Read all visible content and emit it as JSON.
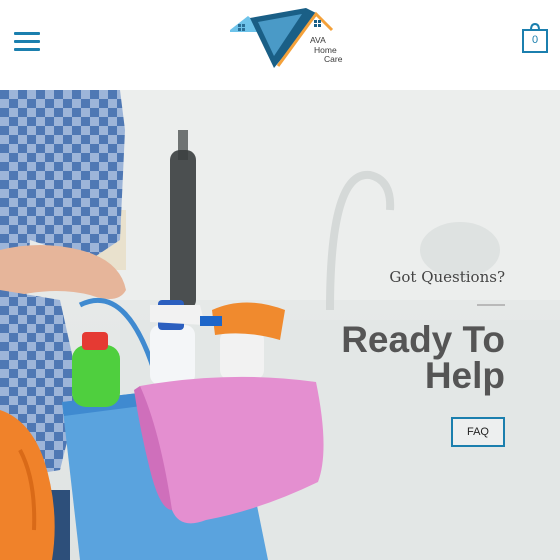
{
  "header": {
    "logo": {
      "line1": "AVA",
      "line2": "Home",
      "line3": "Care"
    },
    "cart": {
      "count": "0"
    }
  },
  "hero": {
    "eyebrow": "Got Questions?",
    "headline_line1": "Ready To",
    "headline_line2": "Help",
    "cta_label": "FAQ"
  },
  "colors": {
    "accent": "#1b7fae",
    "logo_light_blue": "#6ec3ea",
    "logo_dark_blue": "#1a5f86",
    "logo_orange": "#f4a13a",
    "heading_gray": "#555555"
  },
  "icons": [
    "menu-icon",
    "cart-bag-icon",
    "house-logo-icon"
  ]
}
